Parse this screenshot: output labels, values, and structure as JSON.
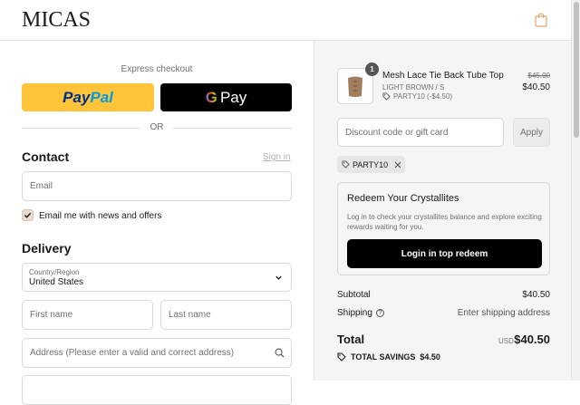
{
  "header": {
    "logo": "MICAS",
    "cart_icon": "shopping-bag-icon"
  },
  "express": {
    "title": "Express checkout",
    "paypal_part1": "Pay",
    "paypal_part2": "Pal",
    "gpay_g": "G",
    "gpay_label": "Pay",
    "or": "OR"
  },
  "contact": {
    "title": "Contact",
    "sign_in": "Sign in",
    "email_placeholder": "Email",
    "news_label": "Email me with news and offers",
    "news_checked": true
  },
  "delivery": {
    "title": "Delivery",
    "country_label": "Country/Region",
    "country_value": "United States",
    "first_name_placeholder": "First name",
    "last_name_placeholder": "Last name",
    "address_placeholder": "Address (Please enter a valid and correct address)"
  },
  "summary": {
    "product": {
      "name": "Mesh Lace Tie Back Tube Top",
      "variant": "LIGHT BROWN / S",
      "discount": "PARTY10 (-$4.50)",
      "quantity": "1",
      "price_original": "$45.00",
      "price_final": "$40.50"
    },
    "discount_placeholder": "Discount code or gift card",
    "apply_label": "Apply",
    "applied_code": "PARTY10",
    "redeem": {
      "title": "Redeem Your Crystallites",
      "description": "Log in to check your crystallites balance and explore exciting rewards waiting for you.",
      "button": "Login in top redeem"
    },
    "subtotal_label": "Subtotal",
    "subtotal_value": "$40.50",
    "shipping_label": "Shipping",
    "shipping_value": "Enter shipping address",
    "total_label": "Total",
    "total_currency": "USD",
    "total_value": "$40.50",
    "savings_label": "TOTAL SAVINGS",
    "savings_value": "$4.50"
  },
  "colors": {
    "paypal_yellow": "#ffc439",
    "accent_black": "#000000",
    "summary_bg": "#f5f5f5"
  }
}
